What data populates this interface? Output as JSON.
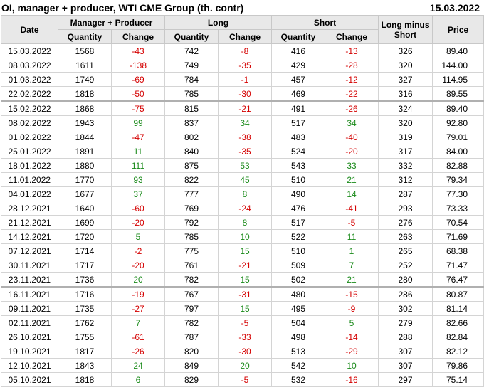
{
  "title": "OI, manager + producer, WTI CME Group (th. contr)",
  "report_date": "15.03.2022",
  "headers": {
    "date": "Date",
    "manager_producer": "Manager + Producer",
    "long": "Long",
    "short": "Short",
    "long_minus_short": "Long minus Short",
    "price": "Price",
    "quantity": "Quantity",
    "change": "Change"
  },
  "colors": {
    "negative": "#d40000",
    "positive": "#1a8a1a"
  },
  "rows": [
    {
      "date": "15.03.2022",
      "mp_qty": "1568",
      "mp_chg": "-43",
      "long_qty": "742",
      "long_chg": "-8",
      "short_qty": "416",
      "short_chg": "-13",
      "lms": "326",
      "price": "89.40"
    },
    {
      "date": "08.03.2022",
      "mp_qty": "1611",
      "mp_chg": "-138",
      "long_qty": "749",
      "long_chg": "-35",
      "short_qty": "429",
      "short_chg": "-28",
      "lms": "320",
      "price": "144.00"
    },
    {
      "date": "01.03.2022",
      "mp_qty": "1749",
      "mp_chg": "-69",
      "long_qty": "784",
      "long_chg": "-1",
      "short_qty": "457",
      "short_chg": "-12",
      "lms": "327",
      "price": "114.95"
    },
    {
      "date": "22.02.2022",
      "mp_qty": "1818",
      "mp_chg": "-50",
      "long_qty": "785",
      "long_chg": "-30",
      "short_qty": "469",
      "short_chg": "-22",
      "lms": "316",
      "price": "89.55"
    },
    {
      "date": "15.02.2022",
      "mp_qty": "1868",
      "mp_chg": "-75",
      "long_qty": "815",
      "long_chg": "-21",
      "short_qty": "491",
      "short_chg": "-26",
      "lms": "324",
      "price": "89.40"
    },
    {
      "date": "08.02.2022",
      "mp_qty": "1943",
      "mp_chg": "99",
      "long_qty": "837",
      "long_chg": "34",
      "short_qty": "517",
      "short_chg": "34",
      "lms": "320",
      "price": "92.80"
    },
    {
      "date": "01.02.2022",
      "mp_qty": "1844",
      "mp_chg": "-47",
      "long_qty": "802",
      "long_chg": "-38",
      "short_qty": "483",
      "short_chg": "-40",
      "lms": "319",
      "price": "79.01"
    },
    {
      "date": "25.01.2022",
      "mp_qty": "1891",
      "mp_chg": "11",
      "long_qty": "840",
      "long_chg": "-35",
      "short_qty": "524",
      "short_chg": "-20",
      "lms": "317",
      "price": "84.00"
    },
    {
      "date": "18.01.2022",
      "mp_qty": "1880",
      "mp_chg": "111",
      "long_qty": "875",
      "long_chg": "53",
      "short_qty": "543",
      "short_chg": "33",
      "lms": "332",
      "price": "82.88"
    },
    {
      "date": "11.01.2022",
      "mp_qty": "1770",
      "mp_chg": "93",
      "long_qty": "822",
      "long_chg": "45",
      "short_qty": "510",
      "short_chg": "21",
      "lms": "312",
      "price": "79.34"
    },
    {
      "date": "04.01.2022",
      "mp_qty": "1677",
      "mp_chg": "37",
      "long_qty": "777",
      "long_chg": "8",
      "short_qty": "490",
      "short_chg": "14",
      "lms": "287",
      "price": "77.30"
    },
    {
      "date": "28.12.2021",
      "mp_qty": "1640",
      "mp_chg": "-60",
      "long_qty": "769",
      "long_chg": "-24",
      "short_qty": "476",
      "short_chg": "-41",
      "lms": "293",
      "price": "73.33"
    },
    {
      "date": "21.12.2021",
      "mp_qty": "1699",
      "mp_chg": "-20",
      "long_qty": "792",
      "long_chg": "8",
      "short_qty": "517",
      "short_chg": "-5",
      "lms": "276",
      "price": "70.54"
    },
    {
      "date": "14.12.2021",
      "mp_qty": "1720",
      "mp_chg": "5",
      "long_qty": "785",
      "long_chg": "10",
      "short_qty": "522",
      "short_chg": "11",
      "lms": "263",
      "price": "71.69"
    },
    {
      "date": "07.12.2021",
      "mp_qty": "1714",
      "mp_chg": "-2",
      "long_qty": "775",
      "long_chg": "15",
      "short_qty": "510",
      "short_chg": "1",
      "lms": "265",
      "price": "68.38"
    },
    {
      "date": "30.11.2021",
      "mp_qty": "1717",
      "mp_chg": "-20",
      "long_qty": "761",
      "long_chg": "-21",
      "short_qty": "509",
      "short_chg": "7",
      "lms": "252",
      "price": "71.47"
    },
    {
      "date": "23.11.2021",
      "mp_qty": "1736",
      "mp_chg": "20",
      "long_qty": "782",
      "long_chg": "15",
      "short_qty": "502",
      "short_chg": "21",
      "lms": "280",
      "price": "76.47"
    },
    {
      "date": "16.11.2021",
      "mp_qty": "1716",
      "mp_chg": "-19",
      "long_qty": "767",
      "long_chg": "-31",
      "short_qty": "480",
      "short_chg": "-15",
      "lms": "286",
      "price": "80.87"
    },
    {
      "date": "09.11.2021",
      "mp_qty": "1735",
      "mp_chg": "-27",
      "long_qty": "797",
      "long_chg": "15",
      "short_qty": "495",
      "short_chg": "-9",
      "lms": "302",
      "price": "81.14"
    },
    {
      "date": "02.11.2021",
      "mp_qty": "1762",
      "mp_chg": "7",
      "long_qty": "782",
      "long_chg": "-5",
      "short_qty": "504",
      "short_chg": "5",
      "lms": "279",
      "price": "82.66"
    },
    {
      "date": "26.10.2021",
      "mp_qty": "1755",
      "mp_chg": "-61",
      "long_qty": "787",
      "long_chg": "-33",
      "short_qty": "498",
      "short_chg": "-14",
      "lms": "288",
      "price": "82.84"
    },
    {
      "date": "19.10.2021",
      "mp_qty": "1817",
      "mp_chg": "-26",
      "long_qty": "820",
      "long_chg": "-30",
      "short_qty": "513",
      "short_chg": "-29",
      "lms": "307",
      "price": "82.12"
    },
    {
      "date": "12.10.2021",
      "mp_qty": "1843",
      "mp_chg": "24",
      "long_qty": "849",
      "long_chg": "20",
      "short_qty": "542",
      "short_chg": "10",
      "lms": "307",
      "price": "79.86"
    },
    {
      "date": "05.10.2021",
      "mp_qty": "1818",
      "mp_chg": "6",
      "long_qty": "829",
      "long_chg": "-5",
      "short_qty": "532",
      "short_chg": "-16",
      "lms": "297",
      "price": "75.14"
    }
  ]
}
